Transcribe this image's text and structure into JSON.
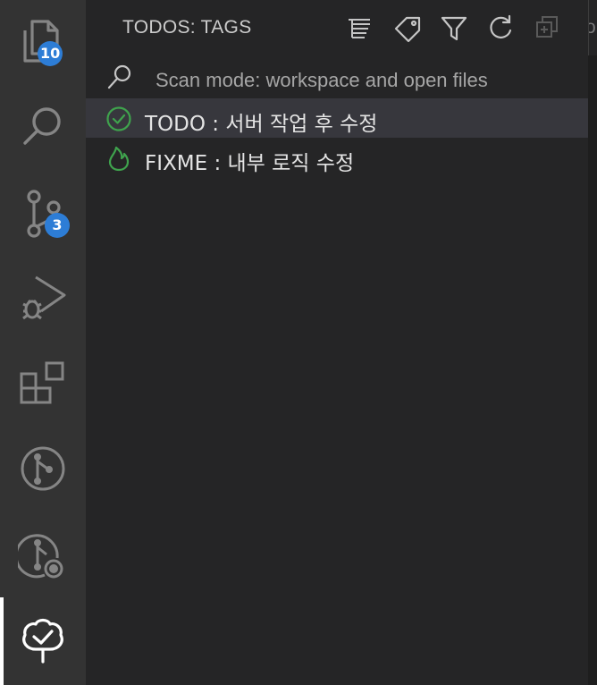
{
  "activity_bar": {
    "items": [
      {
        "name": "explorer",
        "icon": "files-icon",
        "badge": "10"
      },
      {
        "name": "search",
        "icon": "search-icon",
        "badge": ""
      },
      {
        "name": "source-control",
        "icon": "source-control-icon",
        "badge": "3"
      },
      {
        "name": "run-and-debug",
        "icon": "run-debug-icon",
        "badge": ""
      },
      {
        "name": "extensions",
        "icon": "extensions-icon",
        "badge": ""
      },
      {
        "name": "git-graph",
        "icon": "git-branch-circle-icon",
        "badge": ""
      },
      {
        "name": "git-lens",
        "icon": "git-inspect-icon",
        "badge": ""
      },
      {
        "name": "todo-tree",
        "icon": "tree-check-icon",
        "badge": ""
      }
    ],
    "active": "todo-tree",
    "badge_color": "#2d7dd6"
  },
  "panel": {
    "title": "TODOS: TAGS",
    "toolbar": [
      {
        "icon": "tree-view-icon"
      },
      {
        "icon": "tag-icon"
      },
      {
        "icon": "filter-icon"
      },
      {
        "icon": "refresh-icon"
      },
      {
        "icon": "expand-all-icon"
      }
    ],
    "overflow_text": "or",
    "scan_mode": "Scan mode: workspace and open files",
    "items": [
      {
        "tag": "TODO",
        "label": "TODO : 서버 작업 후 수정",
        "icon": "check-circle-icon",
        "selected": true
      },
      {
        "tag": "FIXME",
        "label": "FIXME : 내부 로직 수정",
        "icon": "flame-icon",
        "selected": false
      }
    ]
  },
  "colors": {
    "activity_bar_bg": "#333333",
    "sidebar_bg": "#252526",
    "selection_bg": "#37373d",
    "icon_gray": "#858585",
    "todo_green": "#3fa34d",
    "text": "#cccccc"
  }
}
